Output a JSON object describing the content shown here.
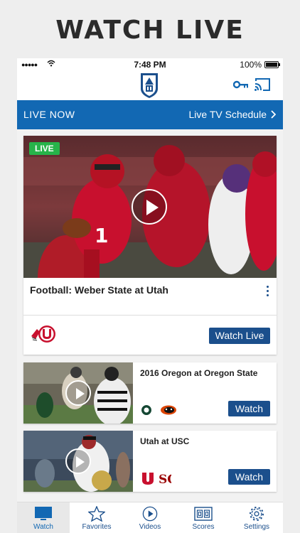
{
  "promo_title": "WATCH LIVE",
  "status_bar": {
    "time": "7:48 PM",
    "battery": "100%"
  },
  "live_bar": {
    "left_label": "LIVE NOW",
    "right_label": "Live TV Schedule"
  },
  "featured": {
    "badge": "LIVE",
    "title": "Football: Weber State at Utah",
    "button_label": "Watch Live"
  },
  "games": [
    {
      "title": "2016 Oregon at Oregon State",
      "button_label": "Watch"
    },
    {
      "title": "Utah at USC",
      "button_label": "Watch"
    }
  ],
  "tabs": [
    {
      "label": "Watch",
      "icon": "tv-icon"
    },
    {
      "label": "Favorites",
      "icon": "star-icon"
    },
    {
      "label": "Videos",
      "icon": "play-circle-icon"
    },
    {
      "label": "Scores",
      "icon": "scoreboard-icon"
    },
    {
      "label": "Settings",
      "icon": "gear-icon"
    }
  ],
  "colors": {
    "accent": "#1268b3",
    "button": "#1b4f8c",
    "live_badge": "#27b34a",
    "utah_red": "#c8102e"
  }
}
